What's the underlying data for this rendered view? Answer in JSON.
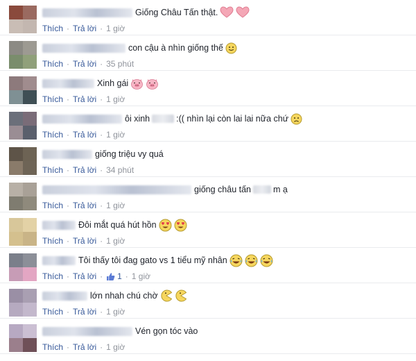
{
  "comments": [
    {
      "text_before": "",
      "text": "Giống Châu Tấn thật.",
      "text_after": "",
      "emoji": [
        "heart-icon",
        "heart-icon"
      ],
      "like_label": "Thích",
      "reply_label": "Trả lời",
      "time": "1 giờ",
      "like_count": ""
    },
    {
      "text_before": "",
      "text": "con cậu à nhìn giống thế",
      "text_after": "",
      "emoji": [
        "slight-smile-icon"
      ],
      "like_label": "Thích",
      "reply_label": "Trả lời",
      "time": "35 phút",
      "like_count": ""
    },
    {
      "text_before": "",
      "text": "Xinh gái",
      "text_after": "",
      "emoji": [
        "pig-face-icon",
        "pig-face-icon"
      ],
      "like_label": "Thích",
      "reply_label": "Trả lời",
      "time": "1 giờ",
      "like_count": ""
    },
    {
      "text_before": "",
      "text": "ôi xinh",
      "text_after": ":(( nhìn lại còn lai lai nữa chứ",
      "emoji": [
        "frown-icon"
      ],
      "like_label": "Thích",
      "reply_label": "Trả lời",
      "time": "1 giờ",
      "like_count": ""
    },
    {
      "text_before": "",
      "text": "giống triệu vy quá",
      "text_after": "",
      "emoji": [],
      "like_label": "Thích",
      "reply_label": "Trả lời",
      "time": "34 phút",
      "like_count": ""
    },
    {
      "text_before": "",
      "text": "giống châu tấn",
      "text_after": "m ạ",
      "emoji": [],
      "like_label": "Thích",
      "reply_label": "Trả lời",
      "time": "1 giờ",
      "like_count": ""
    },
    {
      "text_before": "",
      "text": "Đôi mắt quá hút hồn",
      "text_after": "",
      "emoji": [
        "heart-eyes-icon",
        "heart-eyes-icon"
      ],
      "like_label": "Thích",
      "reply_label": "Trả lời",
      "time": "1 giờ",
      "like_count": ""
    },
    {
      "text_before": "",
      "text": "Tôi thấy tôi đag gato vs 1 tiểu mỹ nhân",
      "text_after": "",
      "emoji": [
        "laughing-tears-icon",
        "laughing-tears-icon",
        "laughing-tears-icon"
      ],
      "like_label": "Thích",
      "reply_label": "Trả lời",
      "time": "1 giờ",
      "like_count": "1"
    },
    {
      "text_before": "",
      "text": "lớn nhah chú chờ",
      "text_after": "",
      "emoji": [
        "pacman-icon",
        "pacman-icon"
      ],
      "like_label": "Thích",
      "reply_label": "Trả lời",
      "time": "1 giờ",
      "like_count": ""
    },
    {
      "text_before": "",
      "text": "Vén gọn tóc vào",
      "text_after": "",
      "emoji": [],
      "like_label": "Thích",
      "reply_label": "Trả lời",
      "time": "1 giờ",
      "like_count": ""
    }
  ],
  "colors": {
    "link": "#365899",
    "meta": "#90949c",
    "text": "#1d2129",
    "divider": "#e9ebee"
  }
}
